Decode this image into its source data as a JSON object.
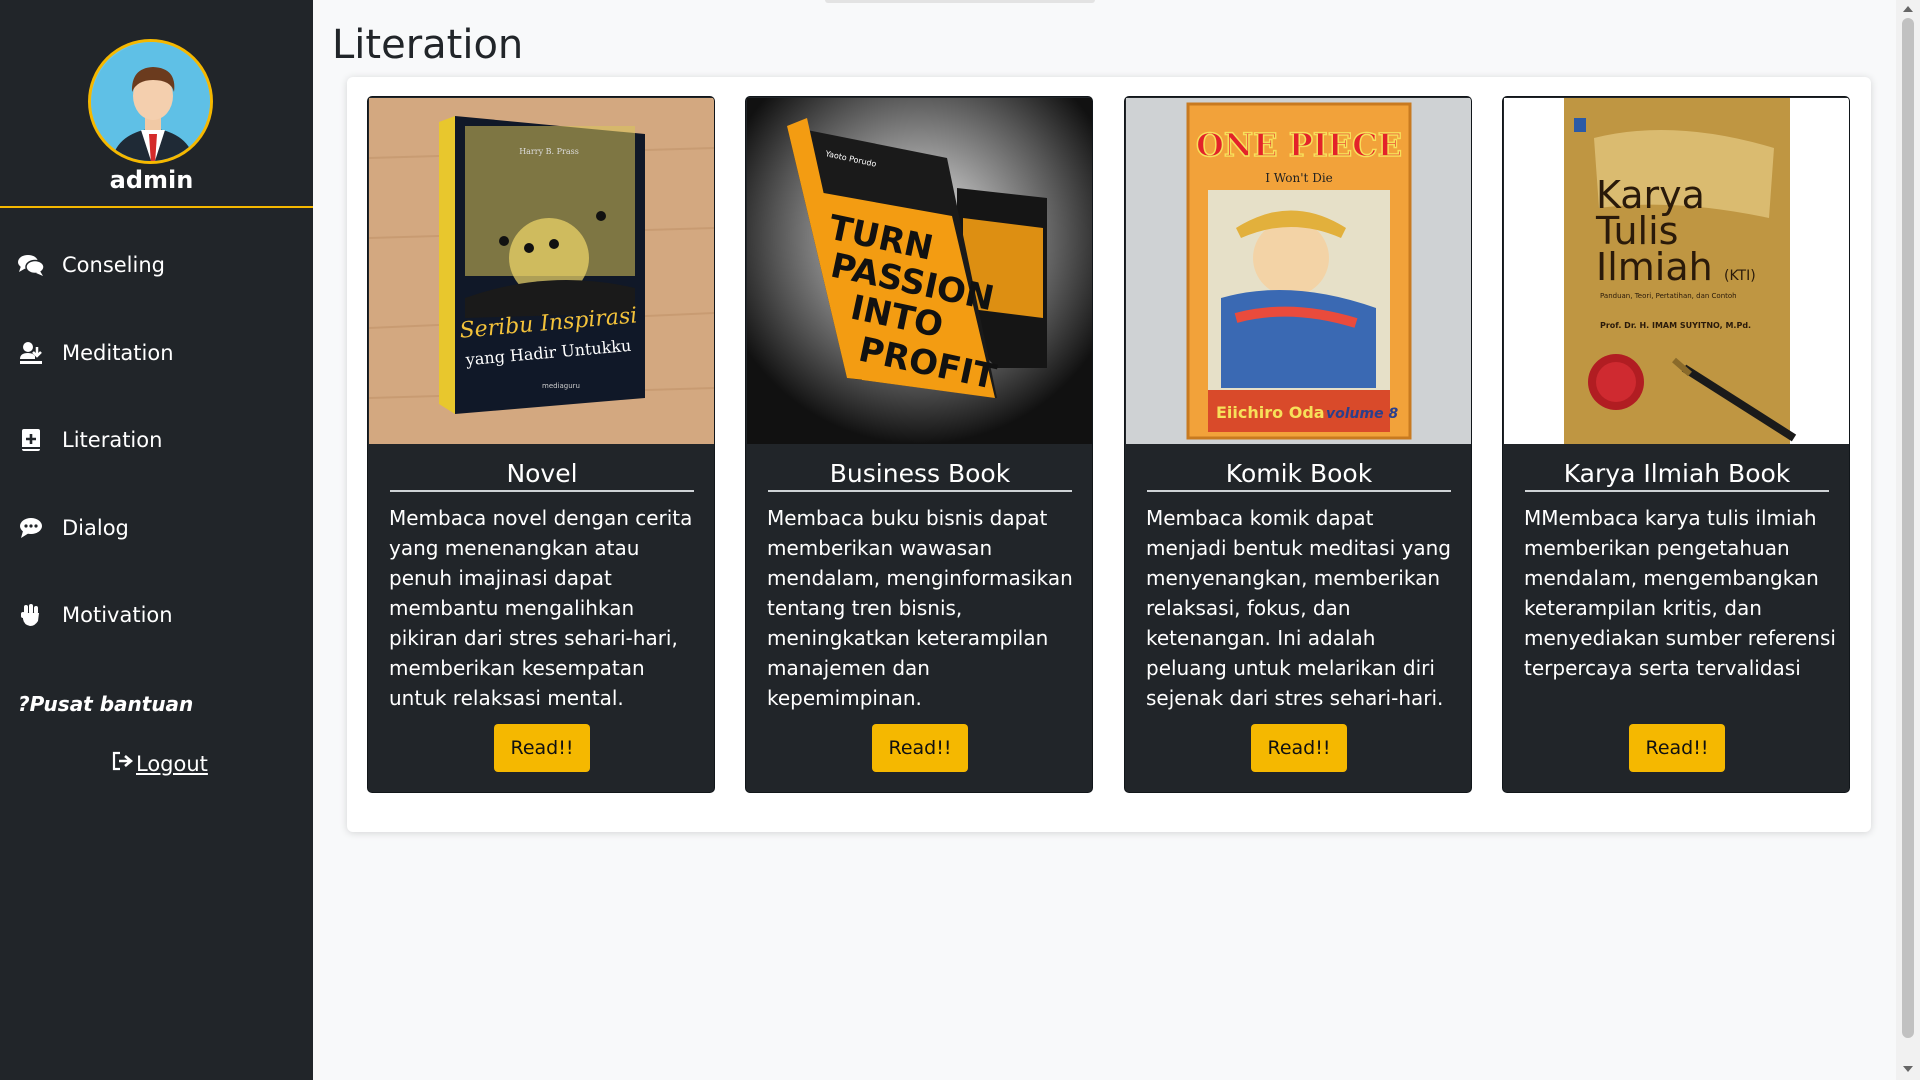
{
  "sidebar": {
    "username": "admin",
    "items": [
      {
        "label": "Conseling",
        "icon": "chat-bubbles-icon"
      },
      {
        "label": "Meditation",
        "icon": "person-download-icon"
      },
      {
        "label": "Literation",
        "icon": "book-plus-icon"
      },
      {
        "label": "Dialog",
        "icon": "comment-dots-icon"
      },
      {
        "label": "Motivation",
        "icon": "fist-icon"
      }
    ],
    "help": "?Pusat bantuan",
    "logout": "Logout"
  },
  "page": {
    "title": "Literation"
  },
  "cards": [
    {
      "title": "Novel",
      "text": "Membaca novel dengan cerita yang menenangkan atau penuh imajinasi dapat membantu mengalihkan pikiran dari stres sehari-hari, memberikan kesempatan untuk relaksasi mental.",
      "button": "Read!!",
      "cover": {
        "line1": "Seribu Inspirasi",
        "line2": "yang Hadir Untukku",
        "author": "Harry B. Prass",
        "publisher": "mediaguru"
      }
    },
    {
      "title": "Business Book",
      "text": "Membaca buku bisnis dapat memberikan wawasan mendalam, menginformasikan tentang tren bisnis, meningkatkan keterampilan manajemen dan kepemimpinan.",
      "button": "Read!!",
      "cover": {
        "line1": "TURN",
        "line2": "PASSION",
        "line3": "INTO",
        "line4": "PROFIT"
      }
    },
    {
      "title": "Komik Book",
      "text": "Membaca komik dapat menjadi bentuk meditasi yang menyenangkan, memberikan relaksasi, fokus, dan ketenangan. Ini adalah peluang untuk melarikan diri sejenak dari stres sehari-hari.",
      "button": "Read!!",
      "cover": {
        "line1": "ONE PIECE",
        "line2": "I Won't Die",
        "author": "Eiichiro Oda",
        "volume": "volume 8"
      }
    },
    {
      "title": "Karya Ilmiah Book",
      "text": "MMembaca karya tulis ilmiah memberikan pengetahuan mendalam, mengembangkan keterampilan kritis, dan menyediakan sumber referensi terpercaya serta tervalidasi",
      "button": "Read!!",
      "cover": {
        "line1": "Karya",
        "line2": "Tulis",
        "line3": "Ilmiah",
        "suffix": "(KTI)",
        "sub": "Panduan, Teori, Pertatihan, dan Contoh",
        "author": "Prof. Dr. H. IMAM SUYITNO, M.Pd."
      }
    }
  ],
  "colors": {
    "sidebar_bg": "#212529",
    "accent": "#f5b800",
    "card_bg": "#212529"
  }
}
